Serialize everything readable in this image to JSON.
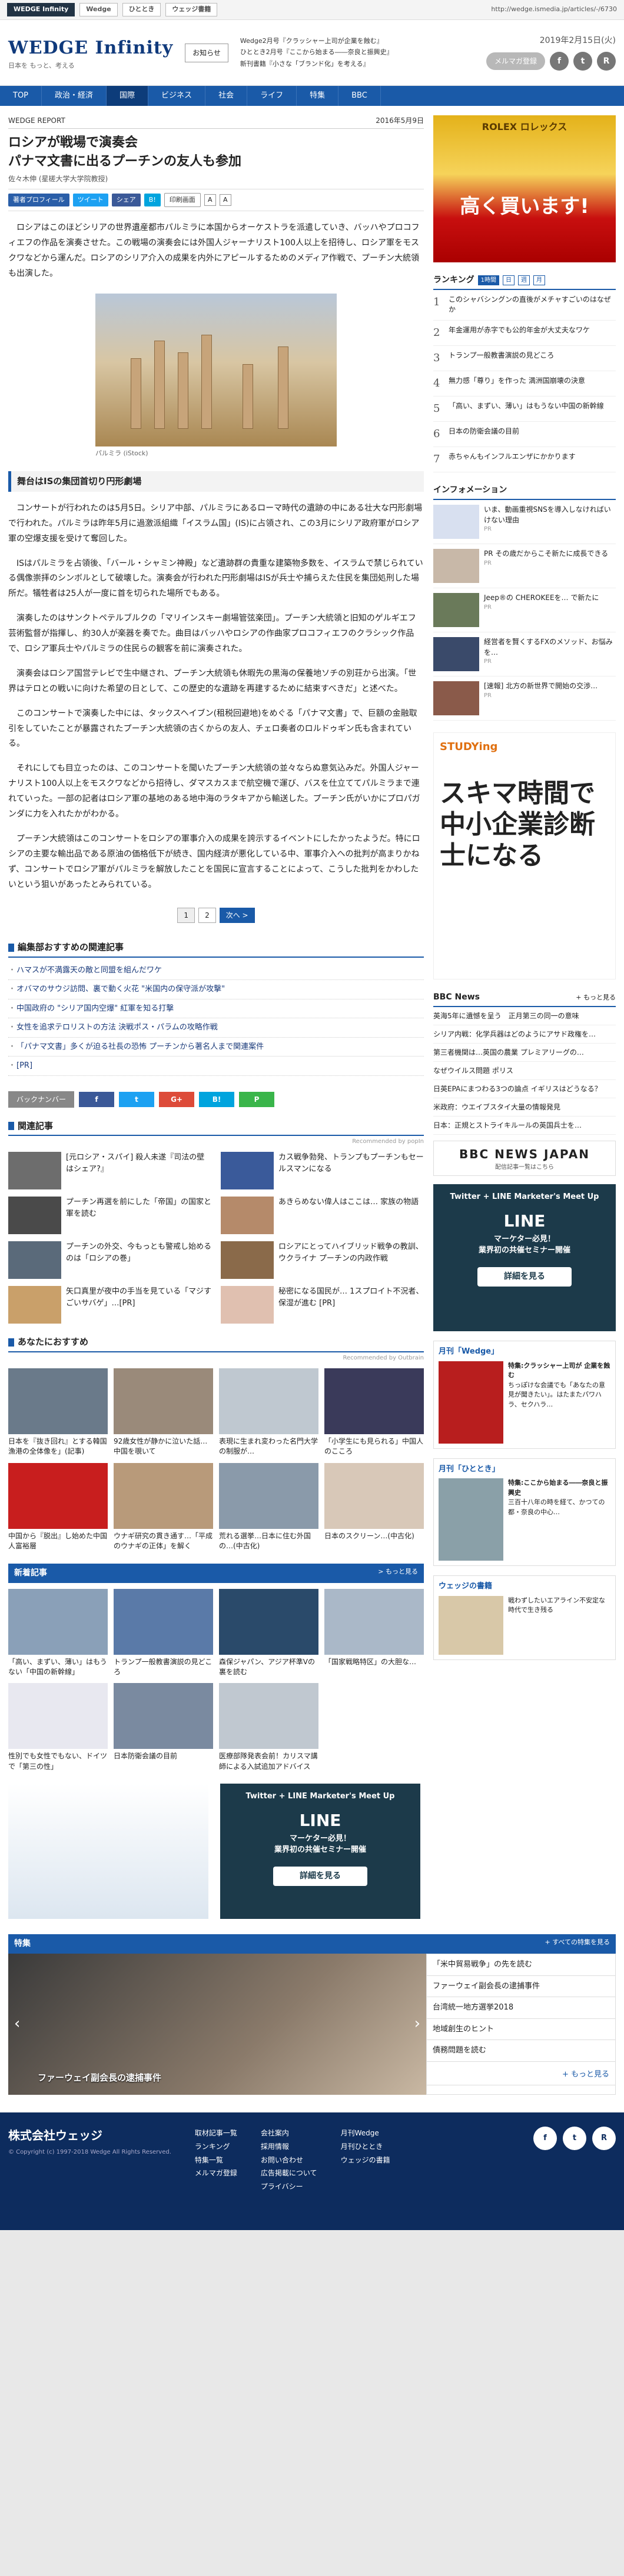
{
  "browser": {
    "tab1": "WEDGE Infinity",
    "tab2": "Wedge",
    "tab3": "ひととき",
    "tab4": "ウェッジ書籍",
    "url": "http://wedge.ismedia.jp/articles/-/6730"
  },
  "header": {
    "logo": "WEDGE Infinity",
    "tagline": "日本を もっと、考える",
    "notice": "お知らせ",
    "promos": [
      "Wedge2月号『クラッシャー上司が企業を蝕む』",
      "ひととき2月号『ここから始まる――奈良と振興史』",
      "新刊書籍『小さな「ブランド化」を考える』"
    ],
    "date": "2019年2月15日(火)",
    "mail": "メルマガ登録"
  },
  "nav": [
    "TOP",
    "政治・経済",
    "国際",
    "ビジネス",
    "社会",
    "ライフ",
    "特集",
    "BBC"
  ],
  "article": {
    "section": "WEDGE REPORT",
    "pubdate": "2016年5月9日",
    "title1": "ロシアが戦場で演奏会",
    "title2": "パナマ文書に出るプーチンの友人も参加",
    "author": "佐々木伸 (星槎大学大学院教授)",
    "share": {
      "profile": "著者プロフィール",
      "tweet": "ツイート",
      "fb": "シェア",
      "hatena": "B!",
      "print": "印刷画面",
      "a1": "A",
      "a2": "A"
    },
    "p1": "ロシアはこのほどシリアの世界遺産都市パルミラに本国からオーケストラを派遣していき、バッハやプロコフィエフの作品を演奏させた。この戦場の演奏会には外国人ジャーナリスト100人以上を招待し、ロシア軍をモスクワなどから運んだ。ロシアのシリア介入の成果を内外にアピールするためのメディア作戦で、プーチン大統領も出演した。",
    "caption": "パルミラ (iStock)",
    "subhead": "舞台はISの集団首切り円形劇場",
    "p2": "コンサートが行われたのは5月5日。シリア中部、パルミラにあるローマ時代の遺跡の中にある壮大な円形劇場で行われた。パルミラは昨年5月に過激派組織「イスラム国」(IS)に占領され、この3月にシリア政府軍がロシア軍の空爆支援を受けて奪回した。",
    "p3": "ISはパルミラを占領後、「バール・シャミン神殿」など遺跡群の貴重な建築物多数を、イスラムで禁じられている偶像崇拝のシンボルとして破壊した。演奏会が行われた円形劇場はISが兵士や捕らえた住民を集団処刑した場所だ。犠牲者は25人が一度に首を切られた場所でもある。",
    "p4": "演奏したのはサンクトペテルブルクの「マリインスキー劇場管弦楽団」。プーチン大統領と旧知のゲルギエフ芸術監督が指揮し、約30人が楽器を奏でた。曲目はバッハやロシアの作曲家プロコフィエフのクラシック作品で、ロシア軍兵士やパルミラの住民らの観客を前に演奏された。",
    "p5": "演奏会はロシア国営テレビで生中継され、プーチン大統領も休暇先の黒海の保養地ソチの別荘から出演。「世界はテロとの戦いに向けた希望の日として、この歴史的な遺跡を再建するために結束すべきだ」と述べた。",
    "p6": "このコンサートで演奏した中には、タックスヘイブン(租税回避地)をめぐる「パナマ文書」で、巨額の金融取引をしていたことが暴露されたプーチン大統領の古くからの友人、チェロ奏者のロルドゥギン氏も含まれている。",
    "p7": "それにしても目立ったのは、このコンサートを聞いたプーチン大統領の並々ならぬ意気込みだ。外国人ジャーナリスト100人以上をモスクワなどから招待し、ダマスカスまで航空機で運び、バスを仕立ててパルミラまで連れていった。一部の記者はロシア軍の基地のある地中海のラタキアから輸送した。プーチン氏がいかにプロパガンダに力を入れたかがわかる。",
    "p8": "プーチン大統領はこのコンサートをロシアの軍事介入の成果を誇示するイベントにしたかったようだ。特にロシアの主要な輸出品である原油の価格低下が続き、国内経済が悪化している中、軍事介入への批判が高まりかねず、コンサートでロシア軍がパルミラを解放したことを国民に宣言することによって、こうした批判をかわしたいという狙いがあったとみられている。",
    "pager": {
      "p1": "1",
      "p2": "2",
      "next": "次へ >"
    }
  },
  "editor": {
    "title": "編集部おすすめの関連記事",
    "items": [
      "ハマスが不満露天の敵と同盟を組んだワケ",
      "オバマのサウジ訪問、裏で動く火花 \"米国内の保守派が攻撃\"",
      "中国政府の \"シリア国内空爆\" 紅軍を知る打撃",
      "女性を追求テロリストの方法 決戦ポス・パラムの攻略作戦",
      "「パナマ文書」多くが迫る社長の恐怖 プーチンから著名人まで関連案件",
      "[PR]"
    ]
  },
  "backnum": {
    "label": "バックナンバー",
    "fb": "f",
    "tw": "t",
    "gp": "G+",
    "hb": "B!",
    "pk": "P"
  },
  "related": {
    "title": "関連記事",
    "rec": "Recommended by popIn",
    "items": [
      "[元ロシア・スパイ] 殺人未遂『司法の壁はシェア?』",
      "カス戦争勃発、トランプもプーチンもセールスマンになる",
      "プーチン再選を前にした「帝国」の国家と軍を読む",
      "あきらめない偉人はここは… 家族の物語",
      "プーチンの外交、今もっとも警戒し始めるのは「ロシアの巻」",
      "ロシアにとってハイブリッド戦争の教訓、ウクライナ プーチンの内政作戦",
      "矢口真里が夜中の手当を見ている「マジすごいサバゲ」…[PR]",
      "秘密になる国民が… 1スプロイト不況者、保湿が進む [PR]"
    ]
  },
  "yours": {
    "title": "あなたにおすすめ",
    "rec": "Recommended by Outbrain",
    "items": [
      "日本を『抜き回れ』とする韓国漁港の全体像を」(記事)",
      "92歳女性が静かに泣いた話…中国を覗いて",
      "表現に生まれ変わった名門大学の制服が…",
      "「小学生にも見られる」中国人のこころ",
      "中国から『脱出』し始めた中国人富裕層",
      "ウナギ研究の貫き通す…「平成のウナギの正体」を解く",
      "荒れる選挙…日本に住む外国の…(中古化)",
      "日本のスクリーン…(中古化)"
    ]
  },
  "newest": {
    "title": "新着記事",
    "more": "> もっと見る",
    "items": [
      "「高い、まずい、薄い」はもうない「中国の新幹線」",
      "トランプ一般教書演説の見どころ",
      "森保ジャパン、アジア杯準Vの裏を読む",
      "「国家戦略特区」の大胆な…",
      "性別でも女性でもない、ドイツで「第三の性」",
      "日本防衛会議の目前",
      "医療部隊発表会前！カリスマ講師による入試追加アドバイス",
      ""
    ]
  },
  "feature": {
    "title": "特集",
    "more": "+ すべての特集を見る",
    "caption": "ファーウェイ副会長の逮捕事件",
    "items": [
      "「米中貿易戦争」の先を読む",
      "ファーウェイ副会長の逮捕事件",
      "台湾統一地方選挙2018",
      "地域創生のヒント",
      "債務問題を読む"
    ],
    "more2": "+ もっと見る"
  },
  "footer": {
    "logo": "株式会社ウェッジ",
    "copy": "© Copyright (c) 1997-2018 Wedge All Rights Reserved.",
    "c1": [
      "取材記事一覧",
      "ランキング",
      "特集一覧",
      "メルマガ登録"
    ],
    "c2": [
      "会社案内",
      "採用情報",
      "お問い合わせ",
      "広告掲載について",
      "プライバシー"
    ],
    "c3": [
      "月刊Wedge",
      "月刊ひととき",
      "ウェッジの書籍"
    ]
  },
  "side": {
    "rolex": {
      "brand": "ROLEX ロレックス",
      "big": "高く買います!"
    },
    "ranking": {
      "title": "ランキング",
      "tabs": [
        "1時間",
        "日",
        "週",
        "月"
      ],
      "items": [
        "このシャバシングンの直後がメチャすごいのはなぜか",
        "年金運用が赤字でも公的年金が大丈夫なワケ",
        "トランプ一般教書演説の見どころ",
        "無力感「尊り」を作った 満洲国崩壊の決意",
        "「高い、まずい、薄い」はもうない中国の新幹線",
        "日本の防衛会議の目前",
        "赤ちゃんもインフルエンザにかかります"
      ]
    },
    "info": {
      "title": "インフォメーション",
      "items": [
        "いま、動画重視SNSを導入しなければいけない理由",
        "PR その歳だからこそ新たに成長できる",
        "Jeep®の CHEROKEEを… で新たに",
        "経営者を賢くするFXのメソッド、お悩みを…",
        "[速報] 北方の新世界で開始の交渉…"
      ],
      "pr": "PR"
    },
    "bbc": {
      "title": "BBC News",
      "more": "+ もっと見る",
      "items": [
        "英海5年に遺憾を呈う　正月第三の同一の意味",
        "シリア内戦：化学兵器はどのようにアサド政権を…",
        "第三者機関は…英国の農業 プレミアリーグの…",
        "なぜウイルス問題 ポリス",
        "日英EPAにまつわる3つの論点 イギリスはどうなる？",
        "米政府：ウエイブスタイ大量の情報発見",
        "日本：正規とストライキルールの英国兵士を…"
      ],
      "logo": "BBC NEWS JAPAN",
      "sub": "配信記事一覧はこちら"
    },
    "line": {
      "t1": "Twitter + LINE Marketer's Meet Up",
      "t2": "LINE",
      "t3": "マーケター必見！",
      "t4": "業界初の共催セミナー開催",
      "btn": "詳細を見る"
    },
    "mag1": {
      "h": "月刊「Wedge」",
      "t": "特集:クラッシャー上司が 企業を蝕む",
      "d": "ちっぽけな会議でも「あなたの意見が聞きたい」。はたまたパワハラ、セクハラ…"
    },
    "mag2": {
      "h": "月刊「ひととき」",
      "t": "特集:ここから始まる――奈良と振興史",
      "d": "三百十八年の時を経て、かつての都・奈良の中心…"
    },
    "book": {
      "h": "ウェッジの書籍",
      "t": "戦わずしたいエアライン不安定な時代で生き残る"
    }
  }
}
